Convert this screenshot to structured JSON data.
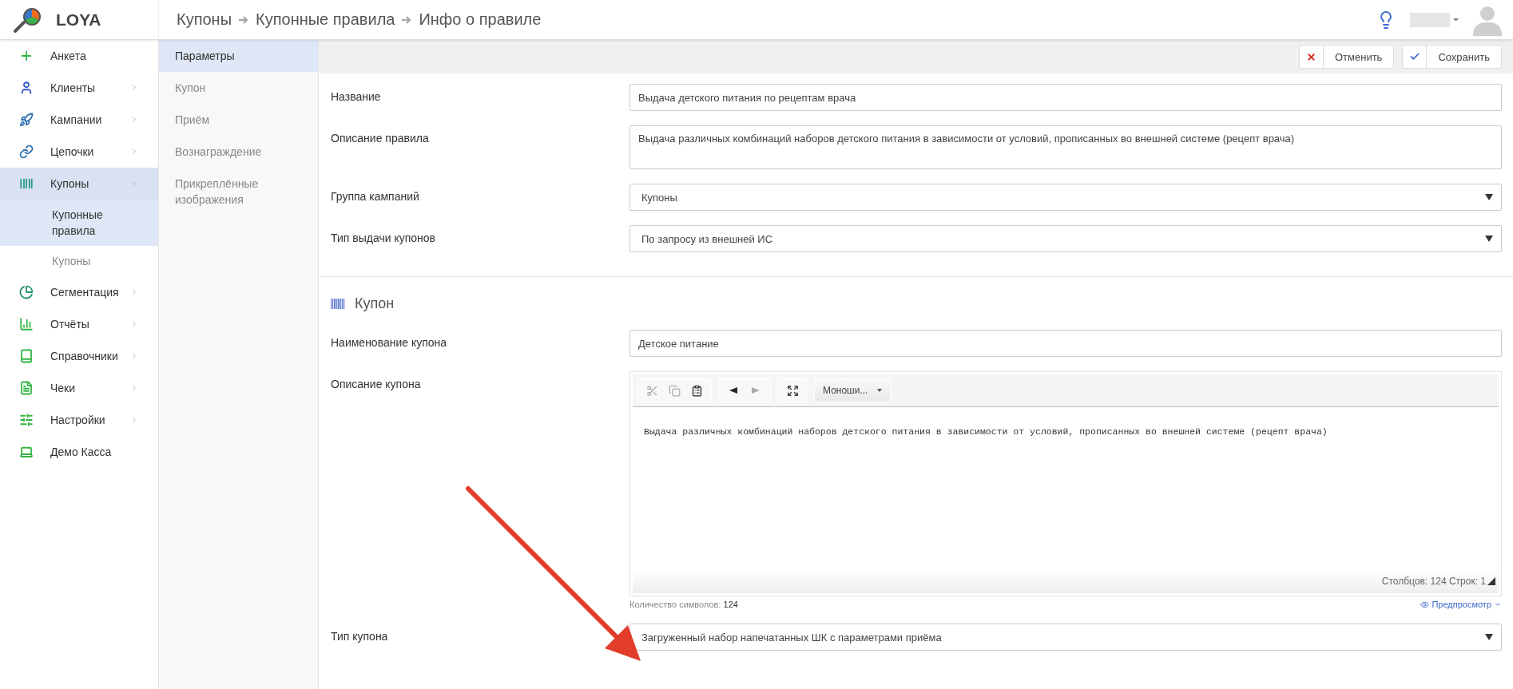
{
  "header": {
    "logo": "LOYA",
    "breadcrumbs": [
      "Купоны",
      "Купонные правила",
      "Инфо о правиле"
    ]
  },
  "sidebar": {
    "items": [
      {
        "kind": "link",
        "label": "Анкета",
        "selected": false
      },
      {
        "kind": "menu",
        "label": "Клиенты",
        "expanded": false,
        "selected": false
      },
      {
        "kind": "menu",
        "label": "Кампании",
        "expanded": false,
        "selected": false
      },
      {
        "kind": "menu",
        "label": "Цепочки",
        "expanded": false,
        "selected": false
      },
      {
        "kind": "menu",
        "label": "Купоны",
        "expanded": true,
        "selected": true,
        "children": [
          {
            "label": "Купонные правила",
            "selected": true
          },
          {
            "label": "Купоны",
            "selected": false
          }
        ]
      },
      {
        "kind": "menu",
        "label": "Сегментация",
        "expanded": false,
        "selected": false
      },
      {
        "kind": "menu",
        "label": "Отчёты",
        "expanded": false,
        "selected": false
      },
      {
        "kind": "menu",
        "label": "Справочники",
        "expanded": false,
        "selected": false
      },
      {
        "kind": "menu",
        "label": "Чеки",
        "expanded": false,
        "selected": false
      },
      {
        "kind": "menu",
        "label": "Настройки",
        "expanded": false,
        "selected": false
      },
      {
        "kind": "link",
        "label": "Демо Касса",
        "selected": false
      }
    ]
  },
  "tabs": [
    {
      "label": "Параметры",
      "selected": true
    },
    {
      "label": "Купон",
      "selected": false
    },
    {
      "label": "Приём",
      "selected": false
    },
    {
      "label": "Вознаграждение",
      "selected": false
    },
    {
      "label": "Прикреплённые изображения",
      "selected": false
    }
  ],
  "actions": [
    {
      "kind": "cancel",
      "label": "Отменить"
    },
    {
      "kind": "save",
      "label": "Сохранить"
    }
  ],
  "form": {
    "fields": [
      {
        "kind": "input",
        "label": "Название",
        "value": "Выдача детского питания по рецептам врача"
      },
      {
        "kind": "textarea",
        "label": "Описание правила",
        "value": "Выдача различных комбинаций наборов детского питания в зависимости от условий, прописанных во внешней системе (рецепт врача)"
      },
      {
        "kind": "select",
        "label": "Группа кампаний",
        "value": "Купоны"
      },
      {
        "kind": "select",
        "label": "Тип выдачи купонов",
        "value": "По запросу из внешней ИС"
      }
    ]
  },
  "coupon_section": {
    "title": "Купон",
    "fields": [
      {
        "kind": "input",
        "label": "Наименование купона",
        "value": "Детское питание"
      },
      {
        "kind": "editor",
        "label": "Описание купона",
        "toolbar_groups": [
          [
            {
              "kind": "cut",
              "disabled": true
            },
            {
              "kind": "copy",
              "disabled": true
            },
            {
              "kind": "paste",
              "disabled": false
            }
          ],
          [
            {
              "kind": "undo",
              "disabled": false
            },
            {
              "kind": "redo",
              "disabled": true
            }
          ],
          [
            {
              "kind": "maximize",
              "disabled": false
            }
          ]
        ],
        "font": "Моноши...",
        "text": "Выдача различных комбинаций наборов детского питания в зависимости от условий, прописанных во внешней системе (рецепт врача)",
        "status": "Столбцов: 124 Строк: 1",
        "counter_label": "Количество символов:",
        "counter_value": "124",
        "preview": "Предпросмотр"
      },
      {
        "kind": "select",
        "label": "Тип купона",
        "value": "Загруженный набор напечатанных ШК с параметрами приёма"
      }
    ]
  }
}
